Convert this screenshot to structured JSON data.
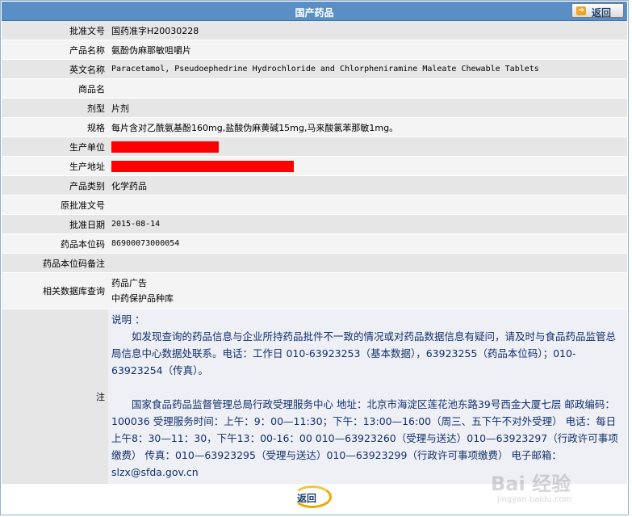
{
  "header": {
    "title": "国产药品",
    "back_label": "返回"
  },
  "fields": {
    "approval_no": {
      "label": "批准文号",
      "value": "国药准字H20030228"
    },
    "product_name": {
      "label": "产品名称",
      "value": "氨酚伪麻那敏咀嚼片"
    },
    "english_name": {
      "label": "英文名称",
      "value": "Paracetamol, Pseudoephedrine Hydrochloride and Chlorpheniramine Maleate Chewable Tablets"
    },
    "trade_name": {
      "label": "商品名",
      "value": ""
    },
    "dosage_form": {
      "label": "剂型",
      "value": "片剂"
    },
    "specification": {
      "label": "规格",
      "value": "每片含对乙酰氨基酚160mg,盐酸伪麻黄碱15mg,马来酸氯苯那敏1mg。"
    },
    "manufacturer": {
      "label": "生产单位",
      "value": ""
    },
    "address": {
      "label": "生产地址",
      "value": ""
    },
    "category": {
      "label": "产品类别",
      "value": "化学药品"
    },
    "original_approval_no": {
      "label": "原批准文号",
      "value": ""
    },
    "approval_date": {
      "label": "批准日期",
      "value": "2015-08-14"
    },
    "drug_code": {
      "label": "药品本位码",
      "value": "86900073000054"
    },
    "drug_code_note": {
      "label": "药品本位码备注",
      "value": ""
    },
    "related_db": {
      "label": "相关数据库查询",
      "links": [
        "药品广告",
        "中药保护品种库"
      ]
    }
  },
  "note": {
    "label": "注",
    "heading": "说明 ：",
    "para1": "如发现查询的药品信息与企业所持药品批件不一致的情况或对药品数据信息有疑问，请及时与食品药品监管总局信息中心数据处联系。电话：工作日 010-63923253（基本数据），63923255（药品本位码）；010-63923254（传真）。",
    "para2": "国家食品药品监督管理总局行政受理服务中心 地址：北京市海淀区莲花池东路39号西金大厦七层 邮政编码：100036 受理服务时间：上午：9：00—11:30；下午：13:00—16:00（周三、五下午不对外受理） 电话：每日上午8：30—11：30，下午13：00-16：00 010—63923260（受理与送达）010—63923297（行政许可事项缴费） 传真：010—63923295（受理与送达）010—63923299（行政许可事项缴费） 电子邮箱：slzx@sfda.gov.cn"
  },
  "footer": {
    "back_label": "返回"
  },
  "watermark": {
    "brand": "Bai 经验",
    "url": "jingyan.baidu.com"
  },
  "colors": {
    "header_bg": "#5a8fc6",
    "redaction": "#ff0000",
    "note_text": "#12306b"
  }
}
